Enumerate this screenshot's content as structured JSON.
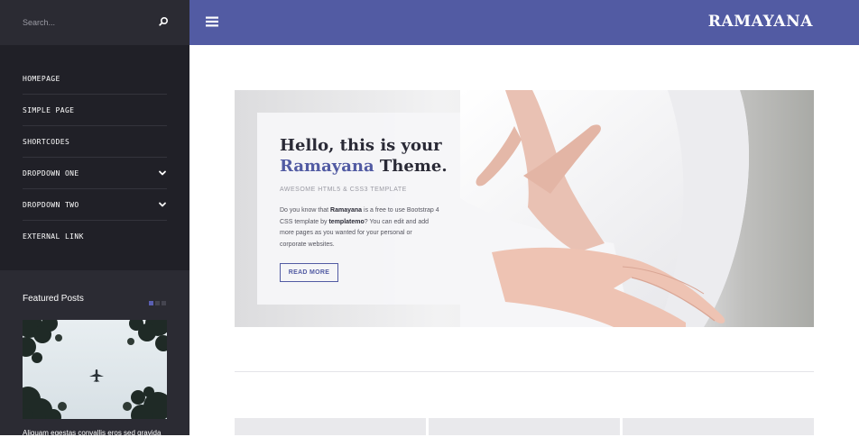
{
  "search": {
    "placeholder": "Search..."
  },
  "sidebar": {
    "items": [
      {
        "label": "HOMEPAGE",
        "has_dropdown": false
      },
      {
        "label": "SIMPLE PAGE",
        "has_dropdown": false
      },
      {
        "label": "SHORTCODES",
        "has_dropdown": false
      },
      {
        "label": "DROPDOWN ONE",
        "has_dropdown": true
      },
      {
        "label": "DROPDOWN TWO",
        "has_dropdown": true
      },
      {
        "label": "EXTERNAL LINK",
        "has_dropdown": false
      }
    ]
  },
  "featured": {
    "title": "Featured Posts",
    "caption": "Aliquam egestas convallis eros sed gravida",
    "slide_count": 3,
    "active_slide": 1
  },
  "topbar": {
    "brand": "RAMAYANA"
  },
  "hero": {
    "title_line1": "Hello, this is your",
    "title_accent": "Ramayana",
    "title_rest": " Theme.",
    "subtitle": "AWESOME HTML5 & CSS3 TEMPLATE",
    "desc_1": "Do you know that ",
    "desc_bold_1": "Ramayana",
    "desc_2": " is a free to use Bootstrap 4 CSS template by ",
    "desc_bold_2": "templatemo",
    "desc_3": "? You can edit and add more pages as you wanted for your personal or corporate websites.",
    "button": "READ MORE"
  },
  "colors": {
    "accent": "#525ba3",
    "sidebar_bg": "#202027",
    "sidebar_panel": "#2b2b33"
  }
}
